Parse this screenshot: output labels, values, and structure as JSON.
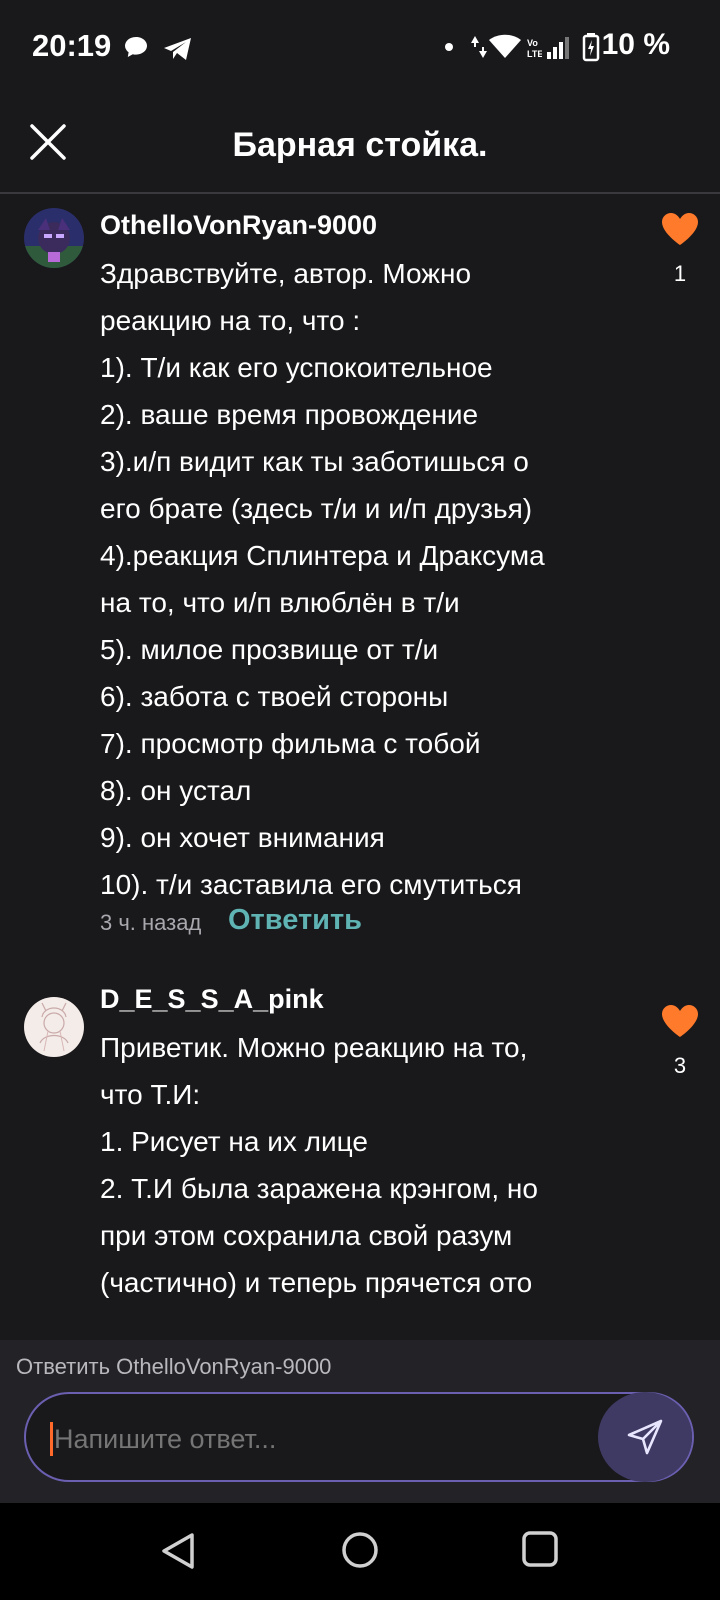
{
  "status_bar": {
    "time": "20:19",
    "battery_percent": "10 %",
    "icons": [
      "chat-bubble-icon",
      "telegram-icon",
      "dot-icon",
      "data-arrows-icon",
      "wifi-icon",
      "volte-icon",
      "signal-icon",
      "battery-icon"
    ]
  },
  "header": {
    "title": "Барная стойка.",
    "close_icon": "close-icon"
  },
  "comments": [
    {
      "author": "OthelloVonRyan-9000",
      "lines": [
        "Здравствуйте, автор. Можно",
        "реакцию на то, что :",
        "1). Т/и как его успокоительное",
        "2). ваше время провождение",
        "3).и/п видит как ты заботишься о",
        "его брате (здесь т/и и  и/п друзья)",
        "4).реакция Сплинтера и Драксума",
        "на то, что и/п влюблён в т/и",
        "5). милое прозвище от т/и",
        "6). забота с твоей стороны",
        "7). просмотр фильма с тобой",
        "8). он устал",
        "9). он хочет внимания",
        "10). т/и заставила его смутиться"
      ],
      "likes": "1",
      "time_ago": "3 ч. назад",
      "reply_label": "Ответить"
    },
    {
      "author": "D_E_S_S_A_pink",
      "lines": [
        "Приветик. Можно реакцию на то,",
        "что Т.И:",
        "1. Рисует на их лице",
        "2. Т.И была заражена крэнгом, но",
        "при этом сохранила свой разум",
        "(частично) и теперь прячется ото"
      ],
      "likes": "3"
    }
  ],
  "reply_bar": {
    "reply_to": "Ответить OthelloVonRyan-9000",
    "placeholder": "Напишите ответ..."
  },
  "colors": {
    "background": "#19181b",
    "like": "#ff7a2b",
    "reply_link": "#5fb3b3",
    "input_border": "#6a5fb0",
    "send_button": "#3f3a63"
  }
}
